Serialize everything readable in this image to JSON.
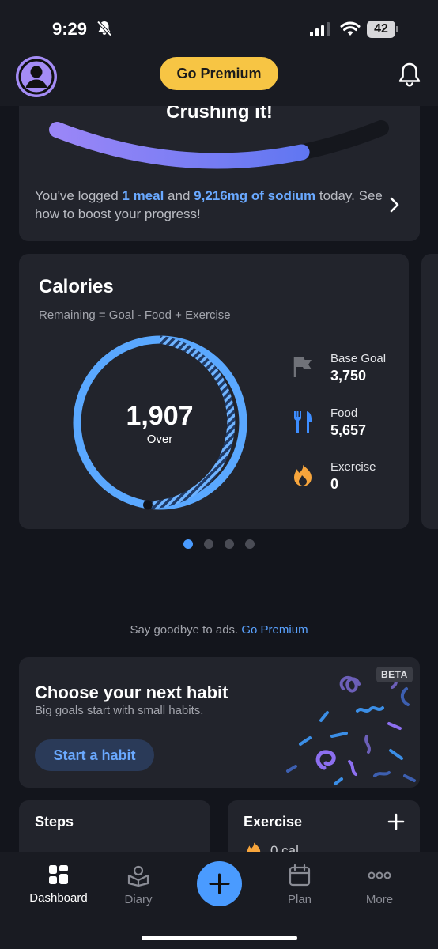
{
  "status_bar": {
    "time": "9:29",
    "battery": "42",
    "icons": [
      "bell-slash-icon",
      "signal-icon",
      "wifi-icon",
      "battery-icon"
    ]
  },
  "header": {
    "premium_label": "Go Premium",
    "icons": [
      "avatar-icon",
      "bell-icon"
    ]
  },
  "progress_card": {
    "title": "Crushing it!",
    "progress_fraction": 0.75,
    "text_before": "You've logged ",
    "meals": "1 meal",
    "text_middle": " and ",
    "sodium": "9,216mg of sodium",
    "text_after": " today. See how to boost your progress!"
  },
  "calories": {
    "title": "Calories",
    "formula": "Remaining = Goal - Food + Exercise",
    "center_value": "1,907",
    "center_label": "Over",
    "stats": [
      {
        "label": "Base Goal",
        "value": "3,750",
        "icon": "flag-icon"
      },
      {
        "label": "Food",
        "value": "5,657",
        "icon": "fork-knife-icon"
      },
      {
        "label": "Exercise",
        "value": "0",
        "icon": "flame-icon"
      }
    ],
    "colors": {
      "ring": "#5aa8ff",
      "stripe": "#3f7fe6",
      "flag": "#707279",
      "food": "#3d8dff",
      "exercise": "#f7a53c"
    }
  },
  "pager": {
    "count": 4,
    "active": 0
  },
  "ads": {
    "text": "Say goodbye to ads.",
    "link": "Go Premium"
  },
  "habit": {
    "title": "Choose your next habit",
    "subtitle": "Big goals start with small habits.",
    "button": "Start a habit",
    "badge": "BETA"
  },
  "steps": {
    "title": "Steps"
  },
  "exercise": {
    "title": "Exercise",
    "value_peek": "0 cal"
  },
  "tabs": [
    {
      "label": "Dashboard",
      "icon": "dashboard-icon",
      "active": true
    },
    {
      "label": "Diary",
      "icon": "diary-icon",
      "active": false
    },
    {
      "label": "Plan",
      "icon": "calendar-icon",
      "active": false
    },
    {
      "label": "More",
      "icon": "more-icon",
      "active": false
    }
  ],
  "accent": "#4a9bff",
  "premium_color": "#f7c544"
}
